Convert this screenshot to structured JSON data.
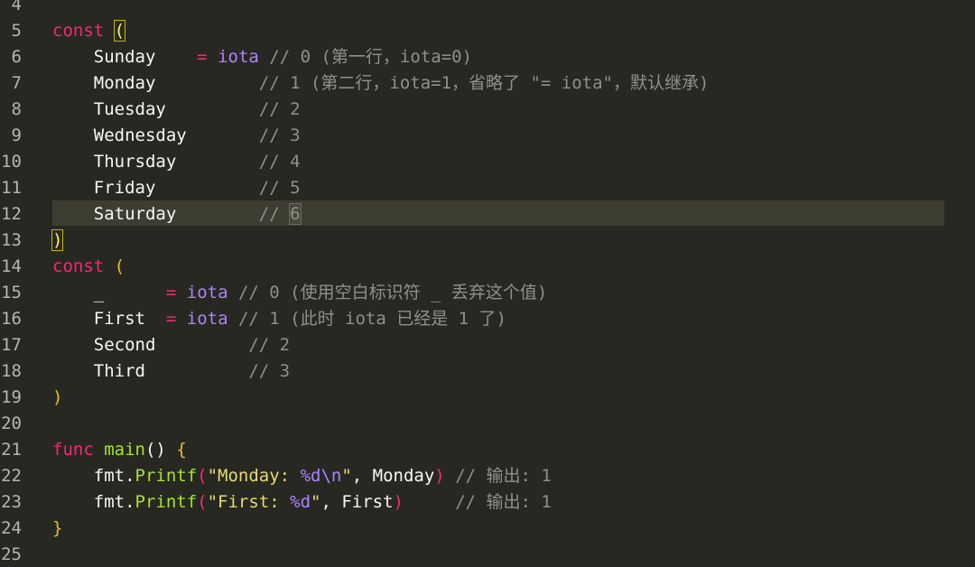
{
  "editor": {
    "lines": [
      {
        "num": "4",
        "tokens": []
      },
      {
        "num": "5",
        "tokens": [
          {
            "text": "const",
            "cls": "kw"
          },
          {
            "text": " ",
            "cls": ""
          },
          {
            "text": "(",
            "cls": "bp"
          }
        ]
      },
      {
        "num": "6",
        "tokens": [
          {
            "text": "    Sunday    ",
            "cls": ""
          },
          {
            "text": "=",
            "cls": "kw"
          },
          {
            "text": " ",
            "cls": ""
          },
          {
            "text": "iota",
            "cls": "cn"
          },
          {
            "text": " // 0 (第一行，iota=0)",
            "cls": "cm"
          }
        ]
      },
      {
        "num": "7",
        "tokens": [
          {
            "text": "    Monday          ",
            "cls": ""
          },
          {
            "text": "// 1 (第二行，iota=1，省略了 \"= iota\"，默认继承)",
            "cls": "cm"
          }
        ]
      },
      {
        "num": "8",
        "tokens": [
          {
            "text": "    Tuesday         ",
            "cls": ""
          },
          {
            "text": "// 2",
            "cls": "cm"
          }
        ]
      },
      {
        "num": "9",
        "tokens": [
          {
            "text": "    Wednesday       ",
            "cls": ""
          },
          {
            "text": "// 3",
            "cls": "cm"
          }
        ]
      },
      {
        "num": "10",
        "tokens": [
          {
            "text": "    Thursday        ",
            "cls": ""
          },
          {
            "text": "// 4",
            "cls": "cm"
          }
        ]
      },
      {
        "num": "11",
        "tokens": [
          {
            "text": "    Friday          ",
            "cls": ""
          },
          {
            "text": "// 5",
            "cls": "cm"
          }
        ]
      },
      {
        "num": "12",
        "tokens": [
          {
            "text": "    Saturday        ",
            "cls": ""
          },
          {
            "text": "// ",
            "cls": "cm"
          },
          {
            "text": "6",
            "cls": "cm cur"
          }
        ]
      },
      {
        "num": "13",
        "tokens": [
          {
            "text": ")",
            "cls": "bp"
          }
        ]
      },
      {
        "num": "14",
        "tokens": [
          {
            "text": "const",
            "cls": "kw"
          },
          {
            "text": " ",
            "cls": ""
          },
          {
            "text": "(",
            "cls": "br"
          }
        ]
      },
      {
        "num": "15",
        "tokens": [
          {
            "text": "    _      ",
            "cls": ""
          },
          {
            "text": "=",
            "cls": "kw"
          },
          {
            "text": " ",
            "cls": ""
          },
          {
            "text": "iota",
            "cls": "cn"
          },
          {
            "text": " // 0 (使用空白标识符 _ 丢弃这个值)",
            "cls": "cm"
          }
        ]
      },
      {
        "num": "16",
        "tokens": [
          {
            "text": "    First  ",
            "cls": ""
          },
          {
            "text": "=",
            "cls": "kw"
          },
          {
            "text": " ",
            "cls": ""
          },
          {
            "text": "iota",
            "cls": "cn"
          },
          {
            "text": " // 1 (此时 iota 已经是 1 了)",
            "cls": "cm"
          }
        ]
      },
      {
        "num": "17",
        "tokens": [
          {
            "text": "    Second         ",
            "cls": ""
          },
          {
            "text": "// 2",
            "cls": "cm"
          }
        ]
      },
      {
        "num": "18",
        "tokens": [
          {
            "text": "    Third          ",
            "cls": ""
          },
          {
            "text": "// 3",
            "cls": "cm"
          }
        ]
      },
      {
        "num": "19",
        "tokens": [
          {
            "text": ")",
            "cls": "br"
          }
        ]
      },
      {
        "num": "20",
        "tokens": []
      },
      {
        "num": "21",
        "tokens": [
          {
            "text": "func",
            "cls": "kw"
          },
          {
            "text": " ",
            "cls": ""
          },
          {
            "text": "main",
            "cls": "fn"
          },
          {
            "text": "() ",
            "cls": ""
          },
          {
            "text": "{",
            "cls": "br"
          }
        ]
      },
      {
        "num": "22",
        "tokens": [
          {
            "text": "    fmt.",
            "cls": ""
          },
          {
            "text": "Printf",
            "cls": "fn"
          },
          {
            "text": "(",
            "cls": "kw"
          },
          {
            "text": "\"Monday: ",
            "cls": "st"
          },
          {
            "text": "%d\\n",
            "cls": "cn"
          },
          {
            "text": "\"",
            "cls": "st"
          },
          {
            "text": ", Monday",
            "cls": ""
          },
          {
            "text": ")",
            "cls": "kw"
          },
          {
            "text": " // 输出: 1",
            "cls": "cm"
          }
        ]
      },
      {
        "num": "23",
        "tokens": [
          {
            "text": "    fmt.",
            "cls": ""
          },
          {
            "text": "Printf",
            "cls": "fn"
          },
          {
            "text": "(",
            "cls": "kw"
          },
          {
            "text": "\"First: ",
            "cls": "st"
          },
          {
            "text": "%d",
            "cls": "cn"
          },
          {
            "text": "\"",
            "cls": "st"
          },
          {
            "text": ", First",
            "cls": ""
          },
          {
            "text": ")",
            "cls": "kw"
          },
          {
            "text": "     // 输出: 1",
            "cls": "cm"
          }
        ]
      },
      {
        "num": "24",
        "tokens": [
          {
            "text": "}",
            "cls": "br"
          }
        ]
      },
      {
        "num": "25",
        "tokens": []
      }
    ]
  },
  "colors": {
    "background": "#272822",
    "keyword": "#f92672",
    "constant": "#ae81ff",
    "comment": "#8f908a",
    "function": "#a6e22e",
    "string": "#e6db74",
    "bracket": "#e6c029",
    "current_line": "#3e3d32"
  }
}
